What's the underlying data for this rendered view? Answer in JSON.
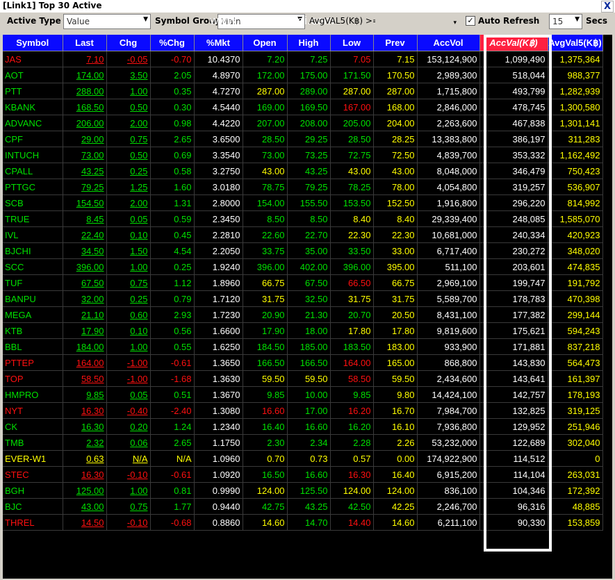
{
  "window": {
    "title": "[Link1] Top 30 Active",
    "close_label": "X"
  },
  "toolbar": {
    "active_type_label": "Active Type :",
    "active_type_value": "Value",
    "symbol_group_label": "Symbol Group :",
    "symbol_group_value": "Main",
    "filter_label": "AvgVAL5(K฿) >=",
    "filter_value": "",
    "auto_refresh_label": "Auto Refresh",
    "auto_refresh_checked": true,
    "interval_value": "15",
    "secs_label": "Secs",
    "watermark": "www.efinancethai.com"
  },
  "colors": {
    "up": "#00e000",
    "down": "#ff1010",
    "flat": "#ffff00",
    "white": "#ffffff",
    "header_bg": "#0a0aff",
    "sorted_header_bg": "#ff2040"
  },
  "columns": [
    "Symbol",
    "Last",
    "Chg",
    "%Chg",
    "%Mkt",
    "Open",
    "High",
    "Low",
    "Prev",
    "AccVol",
    "AccVal(K฿)",
    "AvgVal5(K฿)"
  ],
  "sorted_column": "AccVal(K฿)",
  "rows": [
    {
      "symbol": "JAS",
      "last": "7.10",
      "chg": "-0.05",
      "pchg": "-0.70",
      "pmkt": "10.4370",
      "open": "7.20",
      "high": "7.25",
      "low": "7.05",
      "prev": "7.15",
      "accvol": "153,124,900",
      "accval": "1,099,490",
      "avgval5": "1,375,364",
      "dir": "down",
      "open_dir": "up",
      "high_dir": "up",
      "low_dir": "down"
    },
    {
      "symbol": "AOT",
      "last": "174.00",
      "chg": "3.50",
      "pchg": "2.05",
      "pmkt": "4.8970",
      "open": "172.00",
      "high": "175.00",
      "low": "171.50",
      "prev": "170.50",
      "accvol": "2,989,300",
      "accval": "518,044",
      "avgval5": "988,377",
      "dir": "up",
      "open_dir": "up",
      "high_dir": "up",
      "low_dir": "up"
    },
    {
      "symbol": "PTT",
      "last": "288.00",
      "chg": "1.00",
      "pchg": "0.35",
      "pmkt": "4.7270",
      "open": "287.00",
      "high": "289.00",
      "low": "287.00",
      "prev": "287.00",
      "accvol": "1,715,800",
      "accval": "493,799",
      "avgval5": "1,282,939",
      "dir": "up",
      "open_dir": "flat",
      "high_dir": "up",
      "low_dir": "flat"
    },
    {
      "symbol": "KBANK",
      "last": "168.50",
      "chg": "0.50",
      "pchg": "0.30",
      "pmkt": "4.5440",
      "open": "169.00",
      "high": "169.50",
      "low": "167.00",
      "prev": "168.00",
      "accvol": "2,846,000",
      "accval": "478,745",
      "avgval5": "1,300,580",
      "dir": "up",
      "open_dir": "up",
      "high_dir": "up",
      "low_dir": "down"
    },
    {
      "symbol": "ADVANC",
      "last": "206.00",
      "chg": "2.00",
      "pchg": "0.98",
      "pmkt": "4.4220",
      "open": "207.00",
      "high": "208.00",
      "low": "205.00",
      "prev": "204.00",
      "accvol": "2,263,600",
      "accval": "467,838",
      "avgval5": "1,301,141",
      "dir": "up",
      "open_dir": "up",
      "high_dir": "up",
      "low_dir": "up"
    },
    {
      "symbol": "CPF",
      "last": "29.00",
      "chg": "0.75",
      "pchg": "2.65",
      "pmkt": "3.6500",
      "open": "28.50",
      "high": "29.25",
      "low": "28.50",
      "prev": "28.25",
      "accvol": "13,383,800",
      "accval": "386,197",
      "avgval5": "311,283",
      "dir": "up",
      "open_dir": "up",
      "high_dir": "up",
      "low_dir": "up"
    },
    {
      "symbol": "INTUCH",
      "last": "73.00",
      "chg": "0.50",
      "pchg": "0.69",
      "pmkt": "3.3540",
      "open": "73.00",
      "high": "73.25",
      "low": "72.75",
      "prev": "72.50",
      "accvol": "4,839,700",
      "accval": "353,332",
      "avgval5": "1,162,492",
      "dir": "up",
      "open_dir": "up",
      "high_dir": "up",
      "low_dir": "up"
    },
    {
      "symbol": "CPALL",
      "last": "43.25",
      "chg": "0.25",
      "pchg": "0.58",
      "pmkt": "3.2750",
      "open": "43.00",
      "high": "43.25",
      "low": "43.00",
      "prev": "43.00",
      "accvol": "8,048,000",
      "accval": "346,479",
      "avgval5": "750,423",
      "dir": "up",
      "open_dir": "flat",
      "high_dir": "up",
      "low_dir": "flat"
    },
    {
      "symbol": "PTTGC",
      "last": "79.25",
      "chg": "1.25",
      "pchg": "1.60",
      "pmkt": "3.0180",
      "open": "78.75",
      "high": "79.25",
      "low": "78.25",
      "prev": "78.00",
      "accvol": "4,054,800",
      "accval": "319,257",
      "avgval5": "536,907",
      "dir": "up",
      "open_dir": "up",
      "high_dir": "up",
      "low_dir": "up"
    },
    {
      "symbol": "SCB",
      "last": "154.50",
      "chg": "2.00",
      "pchg": "1.31",
      "pmkt": "2.8000",
      "open": "154.00",
      "high": "155.50",
      "low": "153.50",
      "prev": "152.50",
      "accvol": "1,916,800",
      "accval": "296,220",
      "avgval5": "814,992",
      "dir": "up",
      "open_dir": "up",
      "high_dir": "up",
      "low_dir": "up"
    },
    {
      "symbol": "TRUE",
      "last": "8.45",
      "chg": "0.05",
      "pchg": "0.59",
      "pmkt": "2.3450",
      "open": "8.50",
      "high": "8.50",
      "low": "8.40",
      "prev": "8.40",
      "accvol": "29,339,400",
      "accval": "248,085",
      "avgval5": "1,585,070",
      "dir": "up",
      "open_dir": "up",
      "high_dir": "up",
      "low_dir": "flat"
    },
    {
      "symbol": "IVL",
      "last": "22.40",
      "chg": "0.10",
      "pchg": "0.45",
      "pmkt": "2.2810",
      "open": "22.60",
      "high": "22.70",
      "low": "22.30",
      "prev": "22.30",
      "accvol": "10,681,000",
      "accval": "240,334",
      "avgval5": "420,923",
      "dir": "up",
      "open_dir": "up",
      "high_dir": "up",
      "low_dir": "flat"
    },
    {
      "symbol": "BJCHI",
      "last": "34.50",
      "chg": "1.50",
      "pchg": "4.54",
      "pmkt": "2.2050",
      "open": "33.75",
      "high": "35.00",
      "low": "33.50",
      "prev": "33.00",
      "accvol": "6,717,400",
      "accval": "230,272",
      "avgval5": "348,020",
      "dir": "up",
      "open_dir": "up",
      "high_dir": "up",
      "low_dir": "up"
    },
    {
      "symbol": "SCC",
      "last": "396.00",
      "chg": "1.00",
      "pchg": "0.25",
      "pmkt": "1.9240",
      "open": "396.00",
      "high": "402.00",
      "low": "396.00",
      "prev": "395.00",
      "accvol": "511,100",
      "accval": "203,601",
      "avgval5": "474,835",
      "dir": "up",
      "open_dir": "up",
      "high_dir": "up",
      "low_dir": "up"
    },
    {
      "symbol": "TUF",
      "last": "67.50",
      "chg": "0.75",
      "pchg": "1.12",
      "pmkt": "1.8960",
      "open": "66.75",
      "high": "67.50",
      "low": "66.50",
      "prev": "66.75",
      "accvol": "2,969,100",
      "accval": "199,747",
      "avgval5": "191,792",
      "dir": "up",
      "open_dir": "flat",
      "high_dir": "up",
      "low_dir": "down"
    },
    {
      "symbol": "BANPU",
      "last": "32.00",
      "chg": "0.25",
      "pchg": "0.79",
      "pmkt": "1.7120",
      "open": "31.75",
      "high": "32.50",
      "low": "31.75",
      "prev": "31.75",
      "accvol": "5,589,700",
      "accval": "178,783",
      "avgval5": "470,398",
      "dir": "up",
      "open_dir": "flat",
      "high_dir": "up",
      "low_dir": "flat"
    },
    {
      "symbol": "MEGA",
      "last": "21.10",
      "chg": "0.60",
      "pchg": "2.93",
      "pmkt": "1.7230",
      "open": "20.90",
      "high": "21.30",
      "low": "20.70",
      "prev": "20.50",
      "accvol": "8,431,100",
      "accval": "177,382",
      "avgval5": "299,144",
      "dir": "up",
      "open_dir": "up",
      "high_dir": "up",
      "low_dir": "up"
    },
    {
      "symbol": "KTB",
      "last": "17.90",
      "chg": "0.10",
      "pchg": "0.56",
      "pmkt": "1.6600",
      "open": "17.90",
      "high": "18.00",
      "low": "17.80",
      "prev": "17.80",
      "accvol": "9,819,600",
      "accval": "175,621",
      "avgval5": "594,243",
      "dir": "up",
      "open_dir": "up",
      "high_dir": "up",
      "low_dir": "flat"
    },
    {
      "symbol": "BBL",
      "last": "184.00",
      "chg": "1.00",
      "pchg": "0.55",
      "pmkt": "1.6250",
      "open": "184.50",
      "high": "185.00",
      "low": "183.50",
      "prev": "183.00",
      "accvol": "933,900",
      "accval": "171,881",
      "avgval5": "837,218",
      "dir": "up",
      "open_dir": "up",
      "high_dir": "up",
      "low_dir": "up"
    },
    {
      "symbol": "PTTEP",
      "last": "164.00",
      "chg": "-1.00",
      "pchg": "-0.61",
      "pmkt": "1.3650",
      "open": "166.50",
      "high": "166.50",
      "low": "164.00",
      "prev": "165.00",
      "accvol": "868,800",
      "accval": "143,830",
      "avgval5": "564,473",
      "dir": "down",
      "open_dir": "up",
      "high_dir": "up",
      "low_dir": "down"
    },
    {
      "symbol": "TOP",
      "last": "58.50",
      "chg": "-1.00",
      "pchg": "-1.68",
      "pmkt": "1.3630",
      "open": "59.50",
      "high": "59.50",
      "low": "58.50",
      "prev": "59.50",
      "accvol": "2,434,600",
      "accval": "143,641",
      "avgval5": "161,397",
      "dir": "down",
      "open_dir": "flat",
      "high_dir": "flat",
      "low_dir": "down"
    },
    {
      "symbol": "HMPRO",
      "last": "9.85",
      "chg": "0.05",
      "pchg": "0.51",
      "pmkt": "1.3670",
      "open": "9.85",
      "high": "10.00",
      "low": "9.85",
      "prev": "9.80",
      "accvol": "14,424,100",
      "accval": "142,757",
      "avgval5": "178,193",
      "dir": "up",
      "open_dir": "up",
      "high_dir": "up",
      "low_dir": "up"
    },
    {
      "symbol": "NYT",
      "last": "16.30",
      "chg": "-0.40",
      "pchg": "-2.40",
      "pmkt": "1.3080",
      "open": "16.60",
      "high": "17.00",
      "low": "16.20",
      "prev": "16.70",
      "accvol": "7,984,700",
      "accval": "132,825",
      "avgval5": "319,125",
      "dir": "down",
      "open_dir": "down",
      "high_dir": "up",
      "low_dir": "down"
    },
    {
      "symbol": "CK",
      "last": "16.30",
      "chg": "0.20",
      "pchg": "1.24",
      "pmkt": "1.2340",
      "open": "16.40",
      "high": "16.60",
      "low": "16.20",
      "prev": "16.10",
      "accvol": "7,936,800",
      "accval": "129,952",
      "avgval5": "251,946",
      "dir": "up",
      "open_dir": "up",
      "high_dir": "up",
      "low_dir": "up"
    },
    {
      "symbol": "TMB",
      "last": "2.32",
      "chg": "0.06",
      "pchg": "2.65",
      "pmkt": "1.1750",
      "open": "2.30",
      "high": "2.34",
      "low": "2.28",
      "prev": "2.26",
      "accvol": "53,232,000",
      "accval": "122,689",
      "avgval5": "302,040",
      "dir": "up",
      "open_dir": "up",
      "high_dir": "up",
      "low_dir": "up"
    },
    {
      "symbol": "EVER-W1",
      "last": "0.63",
      "chg": "N/A",
      "pchg": "N/A",
      "pmkt": "1.0960",
      "open": "0.70",
      "high": "0.73",
      "low": "0.57",
      "prev": "0.00",
      "accvol": "174,922,900",
      "accval": "114,512",
      "avgval5": "0",
      "dir": "flat",
      "open_dir": "flat",
      "high_dir": "flat",
      "low_dir": "flat"
    },
    {
      "symbol": "STEC",
      "last": "16.30",
      "chg": "-0.10",
      "pchg": "-0.61",
      "pmkt": "1.0920",
      "open": "16.50",
      "high": "16.60",
      "low": "16.30",
      "prev": "16.40",
      "accvol": "6,915,200",
      "accval": "114,104",
      "avgval5": "263,031",
      "dir": "down",
      "open_dir": "up",
      "high_dir": "up",
      "low_dir": "down"
    },
    {
      "symbol": "BGH",
      "last": "125.00",
      "chg": "1.00",
      "pchg": "0.81",
      "pmkt": "0.9990",
      "open": "124.00",
      "high": "125.50",
      "low": "124.00",
      "prev": "124.00",
      "accvol": "836,100",
      "accval": "104,346",
      "avgval5": "172,392",
      "dir": "up",
      "open_dir": "flat",
      "high_dir": "up",
      "low_dir": "flat"
    },
    {
      "symbol": "BJC",
      "last": "43.00",
      "chg": "0.75",
      "pchg": "1.77",
      "pmkt": "0.9440",
      "open": "42.75",
      "high": "43.25",
      "low": "42.50",
      "prev": "42.25",
      "accvol": "2,246,700",
      "accval": "96,316",
      "avgval5": "48,885",
      "dir": "up",
      "open_dir": "up",
      "high_dir": "up",
      "low_dir": "up"
    },
    {
      "symbol": "THREL",
      "last": "14.50",
      "chg": "-0.10",
      "pchg": "-0.68",
      "pmkt": "0.8860",
      "open": "14.60",
      "high": "14.70",
      "low": "14.40",
      "prev": "14.60",
      "accvol": "6,211,100",
      "accval": "90,330",
      "avgval5": "153,859",
      "dir": "down",
      "open_dir": "flat",
      "high_dir": "up",
      "low_dir": "down"
    }
  ]
}
